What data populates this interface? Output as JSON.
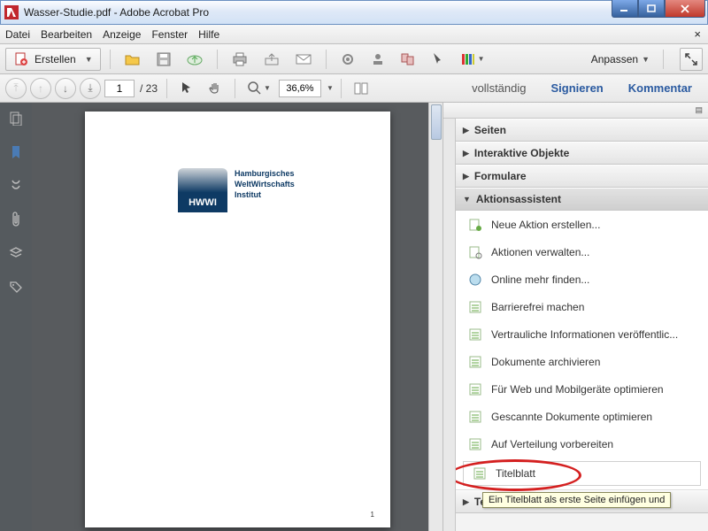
{
  "window": {
    "title": "Wasser-Studie.pdf - Adobe Acrobat Pro"
  },
  "menu": {
    "items": [
      "Datei",
      "Bearbeiten",
      "Anzeige",
      "Fenster",
      "Hilfe"
    ]
  },
  "toolbar": {
    "create": "Erstellen",
    "adjust": "Anpassen"
  },
  "nav": {
    "page_current": "1",
    "page_total": "/  23",
    "zoom": "36,6%",
    "tabs": {
      "voll": "vollständig",
      "sign": "Signieren",
      "comment": "Kommentar"
    }
  },
  "document": {
    "logo_abbrev": "HWWI",
    "logo_full_1": "Hamburgisches",
    "logo_full_2": "WeltWirtschafts",
    "logo_full_3": "Institut",
    "page_number": "1"
  },
  "rightpanel": {
    "sections": {
      "seiten": "Seiten",
      "interaktiv": "Interaktive Objekte",
      "formulare": "Formulare",
      "aktion": "Aktionsassistent",
      "texterkennung": "Texterkennung"
    },
    "actions": [
      "Neue Aktion erstellen...",
      "Aktionen verwalten...",
      "Online mehr finden...",
      "Barrierefrei machen",
      "Vertrauliche Informationen veröffentlic...",
      "Dokumente archivieren",
      "Für Web und Mobilgeräte optimieren",
      "Gescannte Dokumente optimieren",
      "Auf Verteilung vorbereiten",
      "Titelblatt"
    ],
    "tooltip": "Ein Titelblatt als erste Seite einfügen und"
  }
}
